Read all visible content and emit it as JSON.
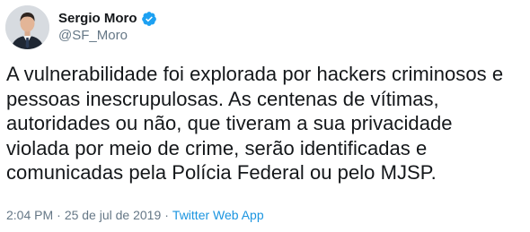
{
  "author": {
    "display_name": "Sergio Moro",
    "handle": "@SF_Moro",
    "verified": true
  },
  "tweet": {
    "lines": [
      "A vulnerabilidade foi explorada por hackers criminosos e",
      "pessoas inescrupulosas. As centenas de vítimas,",
      "autoridades ou não, que tiveram a sua privacidade",
      "violada por meio de crime, serão identificadas e",
      "comunicadas pela Polícia Federal ou pelo MJSP."
    ]
  },
  "meta": {
    "time": "2:04 PM",
    "separator": "·",
    "date": "25 de jul de 2019",
    "source": "Twitter Web App"
  },
  "colors": {
    "text": "#14171a",
    "secondary": "#657786",
    "link": "#1b95e0",
    "verified": "#1da1f2"
  }
}
